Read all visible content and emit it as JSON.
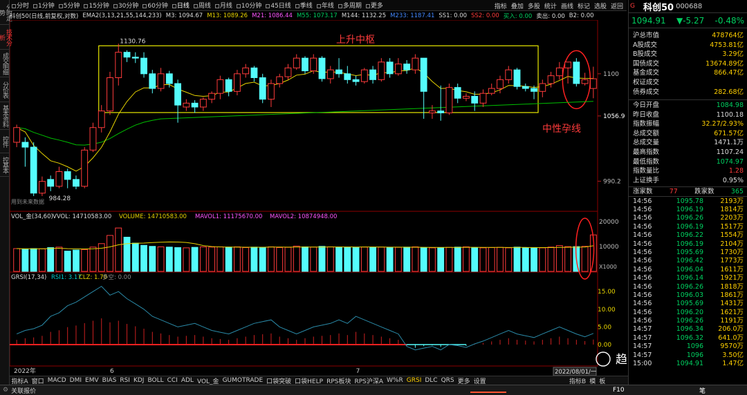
{
  "left_tabs": [
    "分时走势",
    "技术分析",
    "成交明细",
    "分价表",
    "基本资料",
    "控件",
    "控基本"
  ],
  "topbar": {
    "periods": [
      "分时",
      "1分钟",
      "5分钟",
      "15分钟",
      "30分钟",
      "60分钟",
      "日线",
      "周线",
      "月线",
      "10分钟",
      "45日线",
      "季线",
      "年线",
      "多周期",
      "更多"
    ],
    "selected": "日线",
    "right": [
      "指标",
      "叠加",
      "多股",
      "统计",
      "画线",
      "标记",
      "选股",
      "返回"
    ]
  },
  "indicator_line": {
    "name": "科创50(日线,前复权,对数)",
    "ema": "EMA2(3,13,21,55,144,233)",
    "m3": "M3: 1094.67",
    "m13": "M13: 1089.26",
    "m21": "M21: 1086.44",
    "m55": "M55: 1073.17",
    "m144": "M144: 1132.25",
    "m233": "M233: 1187.41",
    "ss1": "SS1: 0.00",
    "ss2": "SS2: 0.00",
    "buy": "买入: 0.00",
    "sell": "卖出: 0.00",
    "b2": "B2: 0.00"
  },
  "annotations": {
    "center": "上升中枢",
    "pattern": "中性孕线",
    "high_label": "1130.76",
    "low_label": "984.28",
    "future": "用到未来数据"
  },
  "axis": {
    "price_ticks": [
      "1100",
      "1056.9",
      "990.2"
    ],
    "vol_ticks": [
      "20000",
      "10000",
      "X1000"
    ],
    "grsi_ticks": [
      "15.00",
      "10.00",
      "5.00",
      "0.00"
    ],
    "date_labels": [
      "2022年",
      "6",
      "7"
    ],
    "date_box": "2022/08/01/一",
    "watermark": "趋势一阳指"
  },
  "vol_header": {
    "name": "VOL_金(34,60)",
    "vvol": "VVOL: 14710583.00",
    "volume": "VOLUME: 14710583.00",
    "mavol1": "MAVOL1: 11175670.00",
    "mavol2": "MAVOL2: 10874948.00"
  },
  "grsi_header": {
    "name": "GRSI(17,34)",
    "rsi1": "RSI1: 3.17",
    "clz": "CLZ: 1.70",
    "dk": "多空: 0.00"
  },
  "bottom_tabs": [
    "指标A",
    "窗口",
    "MACD",
    "DMI",
    "EMV",
    "BIAS",
    "RSI",
    "KDJ",
    "BOLL",
    "CCI",
    "ADL",
    "VOL_金",
    "GUMOTRADE",
    "口袋突破",
    "口袋HELP",
    "RPS板块",
    "RPS沪深A",
    "W%R",
    "GRSI",
    "DLC",
    "QRS",
    "更多",
    "设置"
  ],
  "bottom_selected": "GRSI",
  "bottom_right": [
    "指标B",
    "模",
    "板"
  ],
  "status": {
    "label": "关联报价",
    "f10": "F10",
    "right": "笔"
  },
  "quote": {
    "code_prefix": "G",
    "name": "科创50",
    "code": "000688",
    "price": "1094.91",
    "change": "-5.27",
    "pct": "-0.48%",
    "stats": [
      [
        "沪总市值",
        "478764亿"
      ],
      [
        "A股成交",
        "4753.81亿"
      ],
      [
        "B股成交",
        "3.29亿"
      ],
      [
        "国债成交",
        "13674.89亿"
      ],
      [
        "基金成交",
        "866.47亿"
      ],
      [
        "权证成交",
        ""
      ],
      [
        "债券成交",
        "282.68亿"
      ]
    ],
    "stats2": [
      [
        "今日开盘",
        "1084.98"
      ],
      [
        "昨日收盘",
        "1100.18"
      ],
      [
        "指数振幅",
        "32.27/2.93%"
      ],
      [
        "总成交额",
        "671.57亿"
      ],
      [
        "总成交量",
        "1471.1万"
      ],
      [
        "最高指数",
        "1107.24"
      ],
      [
        "最低指数",
        "1074.97"
      ],
      [
        "指数量比",
        "1.28"
      ],
      [
        "上证换手",
        "0.95%"
      ]
    ],
    "updown": {
      "up_label": "涨家数",
      "up": "77",
      "down_label": "跌家数",
      "down": "365"
    },
    "ticks": [
      [
        "14:56",
        "1095.78",
        "2193万"
      ],
      [
        "14:56",
        "1096.19",
        "1814万"
      ],
      [
        "14:56",
        "1096.26",
        "2203万"
      ],
      [
        "14:56",
        "1096.19",
        "1517万"
      ],
      [
        "14:56",
        "1096.22",
        "1554万"
      ],
      [
        "14:56",
        "1096.19",
        "2104万"
      ],
      [
        "14:56",
        "1095.69",
        "1730万"
      ],
      [
        "14:56",
        "1096.42",
        "1773万"
      ],
      [
        "14:56",
        "1096.04",
        "1611万"
      ],
      [
        "14:56",
        "1096.14",
        "1921万"
      ],
      [
        "14:56",
        "1096.26",
        "1818万"
      ],
      [
        "14:56",
        "1096.03",
        "1861万"
      ],
      [
        "14:56",
        "1095.69",
        "1431万"
      ],
      [
        "14:56",
        "1096.20",
        "1621万"
      ],
      [
        "14:56",
        "1096.26",
        "1191万"
      ],
      [
        "14:57",
        "1096.34",
        "206.0万"
      ],
      [
        "14:57",
        "1096.32",
        "641.0万"
      ],
      [
        "14:57",
        "1096",
        "9570万"
      ],
      [
        "14:57",
        "1096",
        "3.50亿"
      ],
      [
        "15:00",
        "1094.91",
        "1.47亿"
      ]
    ]
  },
  "colors": {
    "up": "#ff3b3b",
    "down": "#54fcfc",
    "ema_yellow": "#e8d400",
    "ema_green": "#00c000",
    "box": "#e8e800",
    "accent": "#ffd000"
  },
  "candles": [
    [
      1030,
      1045,
      1025,
      1048
    ],
    [
      1030,
      1025,
      1005,
      1035
    ],
    [
      1025,
      978,
      975,
      1030
    ],
    [
      978,
      990,
      975,
      995
    ],
    [
      992,
      985,
      980,
      996
    ],
    [
      985,
      1000,
      983,
      1005
    ],
    [
      1000,
      992,
      983,
      1003
    ],
    [
      992,
      985,
      982,
      996
    ],
    [
      985,
      1022,
      983,
      1025
    ],
    [
      1022,
      1045,
      1020,
      1050
    ],
    [
      1045,
      1062,
      1040,
      1068
    ],
    [
      1062,
      1096,
      1058,
      1102
    ],
    [
      1096,
      1122,
      1088,
      1130.76
    ],
    [
      1122,
      1117,
      1112,
      1124
    ],
    [
      1117,
      1116,
      1111,
      1122
    ],
    [
      1116,
      1100,
      1096,
      1122
    ],
    [
      1100,
      1085,
      1080,
      1104
    ],
    [
      1085,
      1100,
      1082,
      1106
    ],
    [
      1100,
      1090,
      1086,
      1103
    ],
    [
      1090,
      1068,
      1050,
      1094
    ],
    [
      1066,
      1070,
      1062,
      1074
    ],
    [
      1070,
      1066,
      1060,
      1073
    ],
    [
      1066,
      1074,
      1062,
      1076
    ],
    [
      1074,
      1080,
      1070,
      1082
    ],
    [
      1080,
      1094,
      1074,
      1098
    ],
    [
      1094,
      1082,
      1077,
      1096
    ],
    [
      1082,
      1100,
      1078,
      1104
    ],
    [
      1100,
      1106,
      1096,
      1110
    ],
    [
      1106,
      1096,
      1092,
      1108
    ],
    [
      1096,
      1074,
      1070,
      1100
    ],
    [
      1074,
      1090,
      1066,
      1094
    ],
    [
      1090,
      1097,
      1086,
      1100
    ],
    [
      1097,
      1106,
      1094,
      1110
    ],
    [
      1106,
      1116,
      1104,
      1120
    ],
    [
      1116,
      1103,
      1100,
      1118
    ],
    [
      1103,
      1116,
      1100,
      1120
    ],
    [
      1116,
      1095,
      1092,
      1118
    ],
    [
      1095,
      1104,
      1090,
      1108
    ],
    [
      1104,
      1100,
      1096,
      1116
    ],
    [
      1100,
      1094,
      1090,
      1108
    ],
    [
      1094,
      1092,
      1088,
      1098
    ],
    [
      1092,
      1104,
      1090,
      1106
    ],
    [
      1104,
      1094,
      1090,
      1108
    ],
    [
      1094,
      1112,
      1092,
      1116
    ],
    [
      1112,
      1100,
      1096,
      1116
    ],
    [
      1100,
      1110,
      1098,
      1116
    ],
    [
      1110,
      1104,
      1100,
      1114
    ],
    [
      1104,
      1116,
      1100,
      1120
    ],
    [
      1116,
      1082,
      1054,
      1114
    ],
    [
      1060,
      1062,
      1054,
      1068
    ],
    [
      1062,
      1060,
      1052,
      1088
    ],
    [
      1060,
      1086,
      1058,
      1090
    ],
    [
      1086,
      1075,
      1070,
      1090
    ],
    [
      1075,
      1077,
      1072,
      1080
    ],
    [
      1077,
      1070,
      1062,
      1082
    ],
    [
      1070,
      1080,
      1066,
      1084
    ],
    [
      1080,
      1085,
      1078,
      1090
    ],
    [
      1085,
      1094,
      1080,
      1098
    ],
    [
      1094,
      1104,
      1090,
      1108
    ],
    [
      1104,
      1087,
      1084,
      1106
    ],
    [
      1087,
      1085,
      1082,
      1090
    ],
    [
      1085,
      1082,
      1074,
      1088
    ],
    [
      1082,
      1090,
      1076,
      1094
    ],
    [
      1090,
      1098,
      1086,
      1102
    ],
    [
      1098,
      1106,
      1094,
      1112
    ],
    [
      1106,
      1112,
      1090,
      1110
    ],
    [
      1112,
      1090,
      1087,
      1116
    ],
    [
      1090,
      1094,
      1088,
      1101
    ],
    [
      1084.98,
      1094.91,
      1074.97,
      1107.24
    ]
  ],
  "volume": [
    9200,
    9000,
    9200,
    9100,
    9600,
    9800,
    8200,
    8600,
    8800,
    9800,
    11200,
    14500,
    17500,
    13800,
    11400,
    10500,
    10100,
    9900,
    9800,
    9600,
    9500,
    9700,
    9900,
    9800,
    9900,
    9800,
    9900,
    9600,
    9800,
    9700,
    9900,
    9600,
    9700,
    10200,
    9900,
    9800,
    10100,
    9900,
    9800,
    9700,
    9600,
    9800,
    9700,
    9800,
    9600,
    9700,
    9800,
    9900,
    9600,
    9500,
    9600,
    9700,
    9800,
    9900,
    9600,
    9500,
    9600,
    9700,
    9500,
    9800,
    9600,
    9400,
    9500,
    9800,
    10400,
    10000,
    10000,
    10100,
    14710
  ],
  "grsi": [
    3,
    4,
    4.5,
    5.5,
    8,
    9,
    11,
    12,
    13.5,
    15,
    16.5,
    14,
    15,
    13,
    11.5,
    10,
    8,
    7,
    6,
    5,
    5.5,
    6,
    5,
    4,
    3.5,
    3,
    4,
    5,
    6,
    6.5,
    7,
    5,
    4,
    3,
    4,
    5,
    5.5,
    6,
    7,
    6,
    8,
    7,
    6,
    5,
    4,
    3,
    -0.5,
    -2,
    -1,
    -0.5,
    -1.5,
    0,
    -0.3,
    -0.8,
    0.2,
    1,
    2,
    3,
    4,
    3,
    2.5,
    2,
    3,
    4,
    5,
    4,
    3,
    2.2,
    3.17
  ]
}
